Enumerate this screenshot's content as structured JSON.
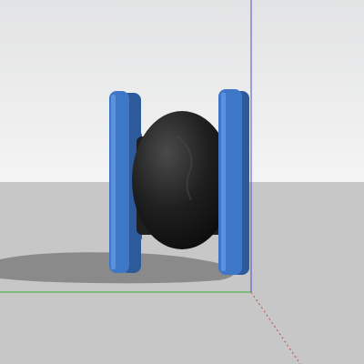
{
  "scene": {
    "subject_icon": "rubber-expansion-joint",
    "colors": {
      "sky_top": "#e2e3e4",
      "sky_bottom": "#f4f4f4",
      "ground": "#c7c7c7",
      "ground_near": "#cbcbcb",
      "shadow": "#8a8a8a",
      "flange": "#3e77c8",
      "flange_dark": "#2d5a9b",
      "flange_light": "#5a92dc",
      "bellows": "#1f1f1f",
      "bellows_highlight": "#4a4a4a",
      "axis_green": "#2fae2f",
      "axis_blue": "#4b4bd6",
      "axis_red": "#c44848"
    }
  }
}
